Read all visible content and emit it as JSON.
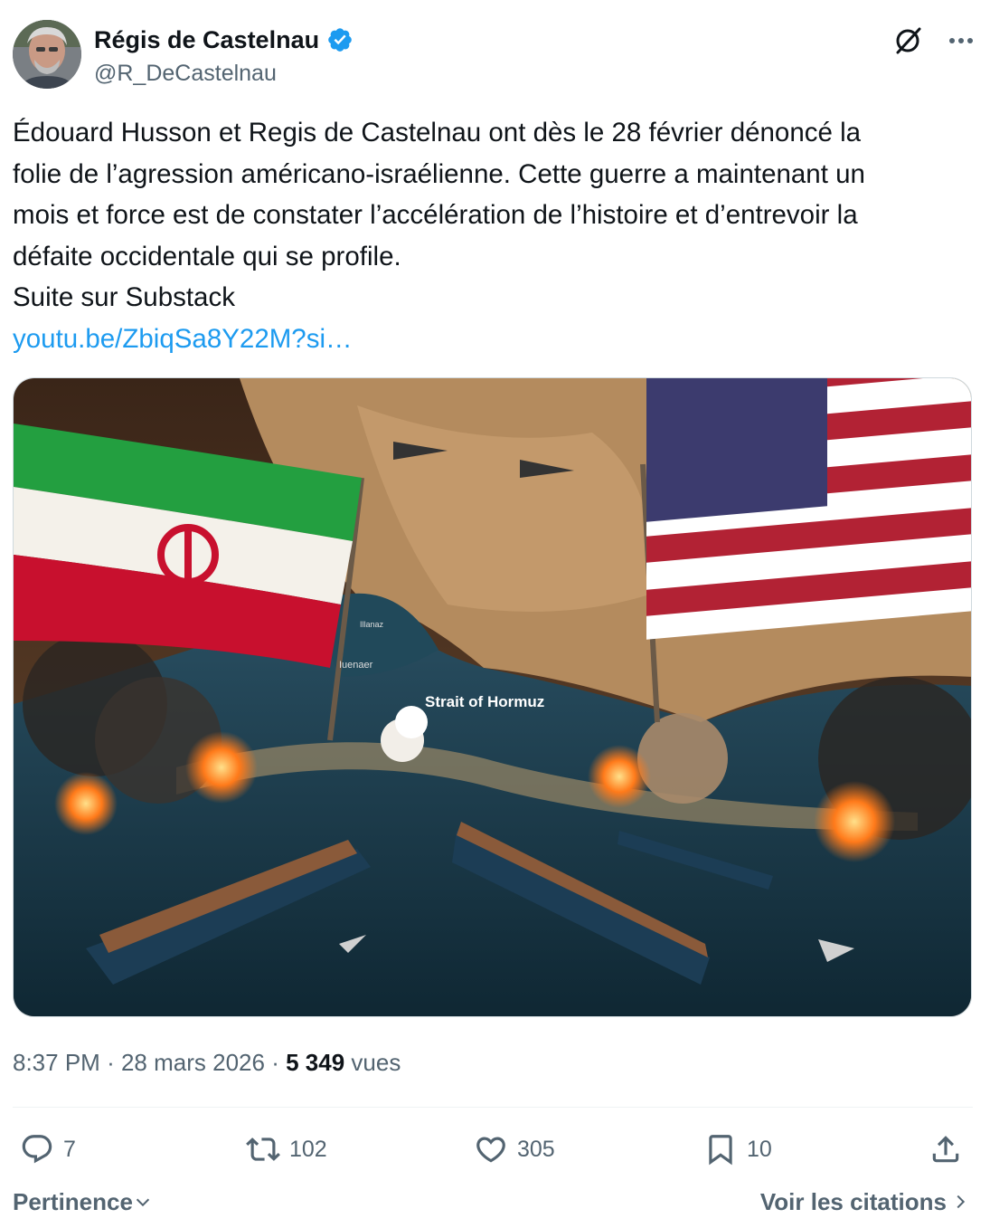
{
  "author": {
    "name": "Régis de Castelnau",
    "handle": "@R_DeCastelnau"
  },
  "tweet": {
    "lines": [
      "Édouard Husson et Regis de Castelnau ont dès le 28 février dénoncé la",
      "folie de l’agression américano-israélienne. Cette guerre a maintenant un",
      "mois et force est de constater l’accélération de l’histoire et d’entrevoir la",
      "défaite occidentale qui se profile.",
      "Suite sur Substack"
    ],
    "link": "youtu.be/ZbiqSa8Y22M?si…"
  },
  "media": {
    "map_label": "Strait of Hormuz",
    "small_label_1": "Illanaz",
    "small_label_2": "Iuenaer"
  },
  "meta": {
    "time": "8:37 PM",
    "separator": "·",
    "date": "28 mars 2026",
    "views": "5 349",
    "views_label": "vues"
  },
  "actions": {
    "replies": "7",
    "reposts": "102",
    "likes": "305",
    "bookmarks": "10"
  },
  "footer": {
    "sort_label": "Pertinence",
    "quotes_label": "Voir les citations"
  },
  "colors": {
    "link": "#1d9bf0",
    "verified": "#1d9bf0",
    "secondary_text": "#536471",
    "primary_text": "#0f1419"
  },
  "icons": [
    "verified-badge-icon",
    "grok-icon",
    "more-icon",
    "reply-icon",
    "repost-icon",
    "like-icon",
    "bookmark-icon",
    "share-icon",
    "chevron-down-icon",
    "chevron-right-icon"
  ]
}
